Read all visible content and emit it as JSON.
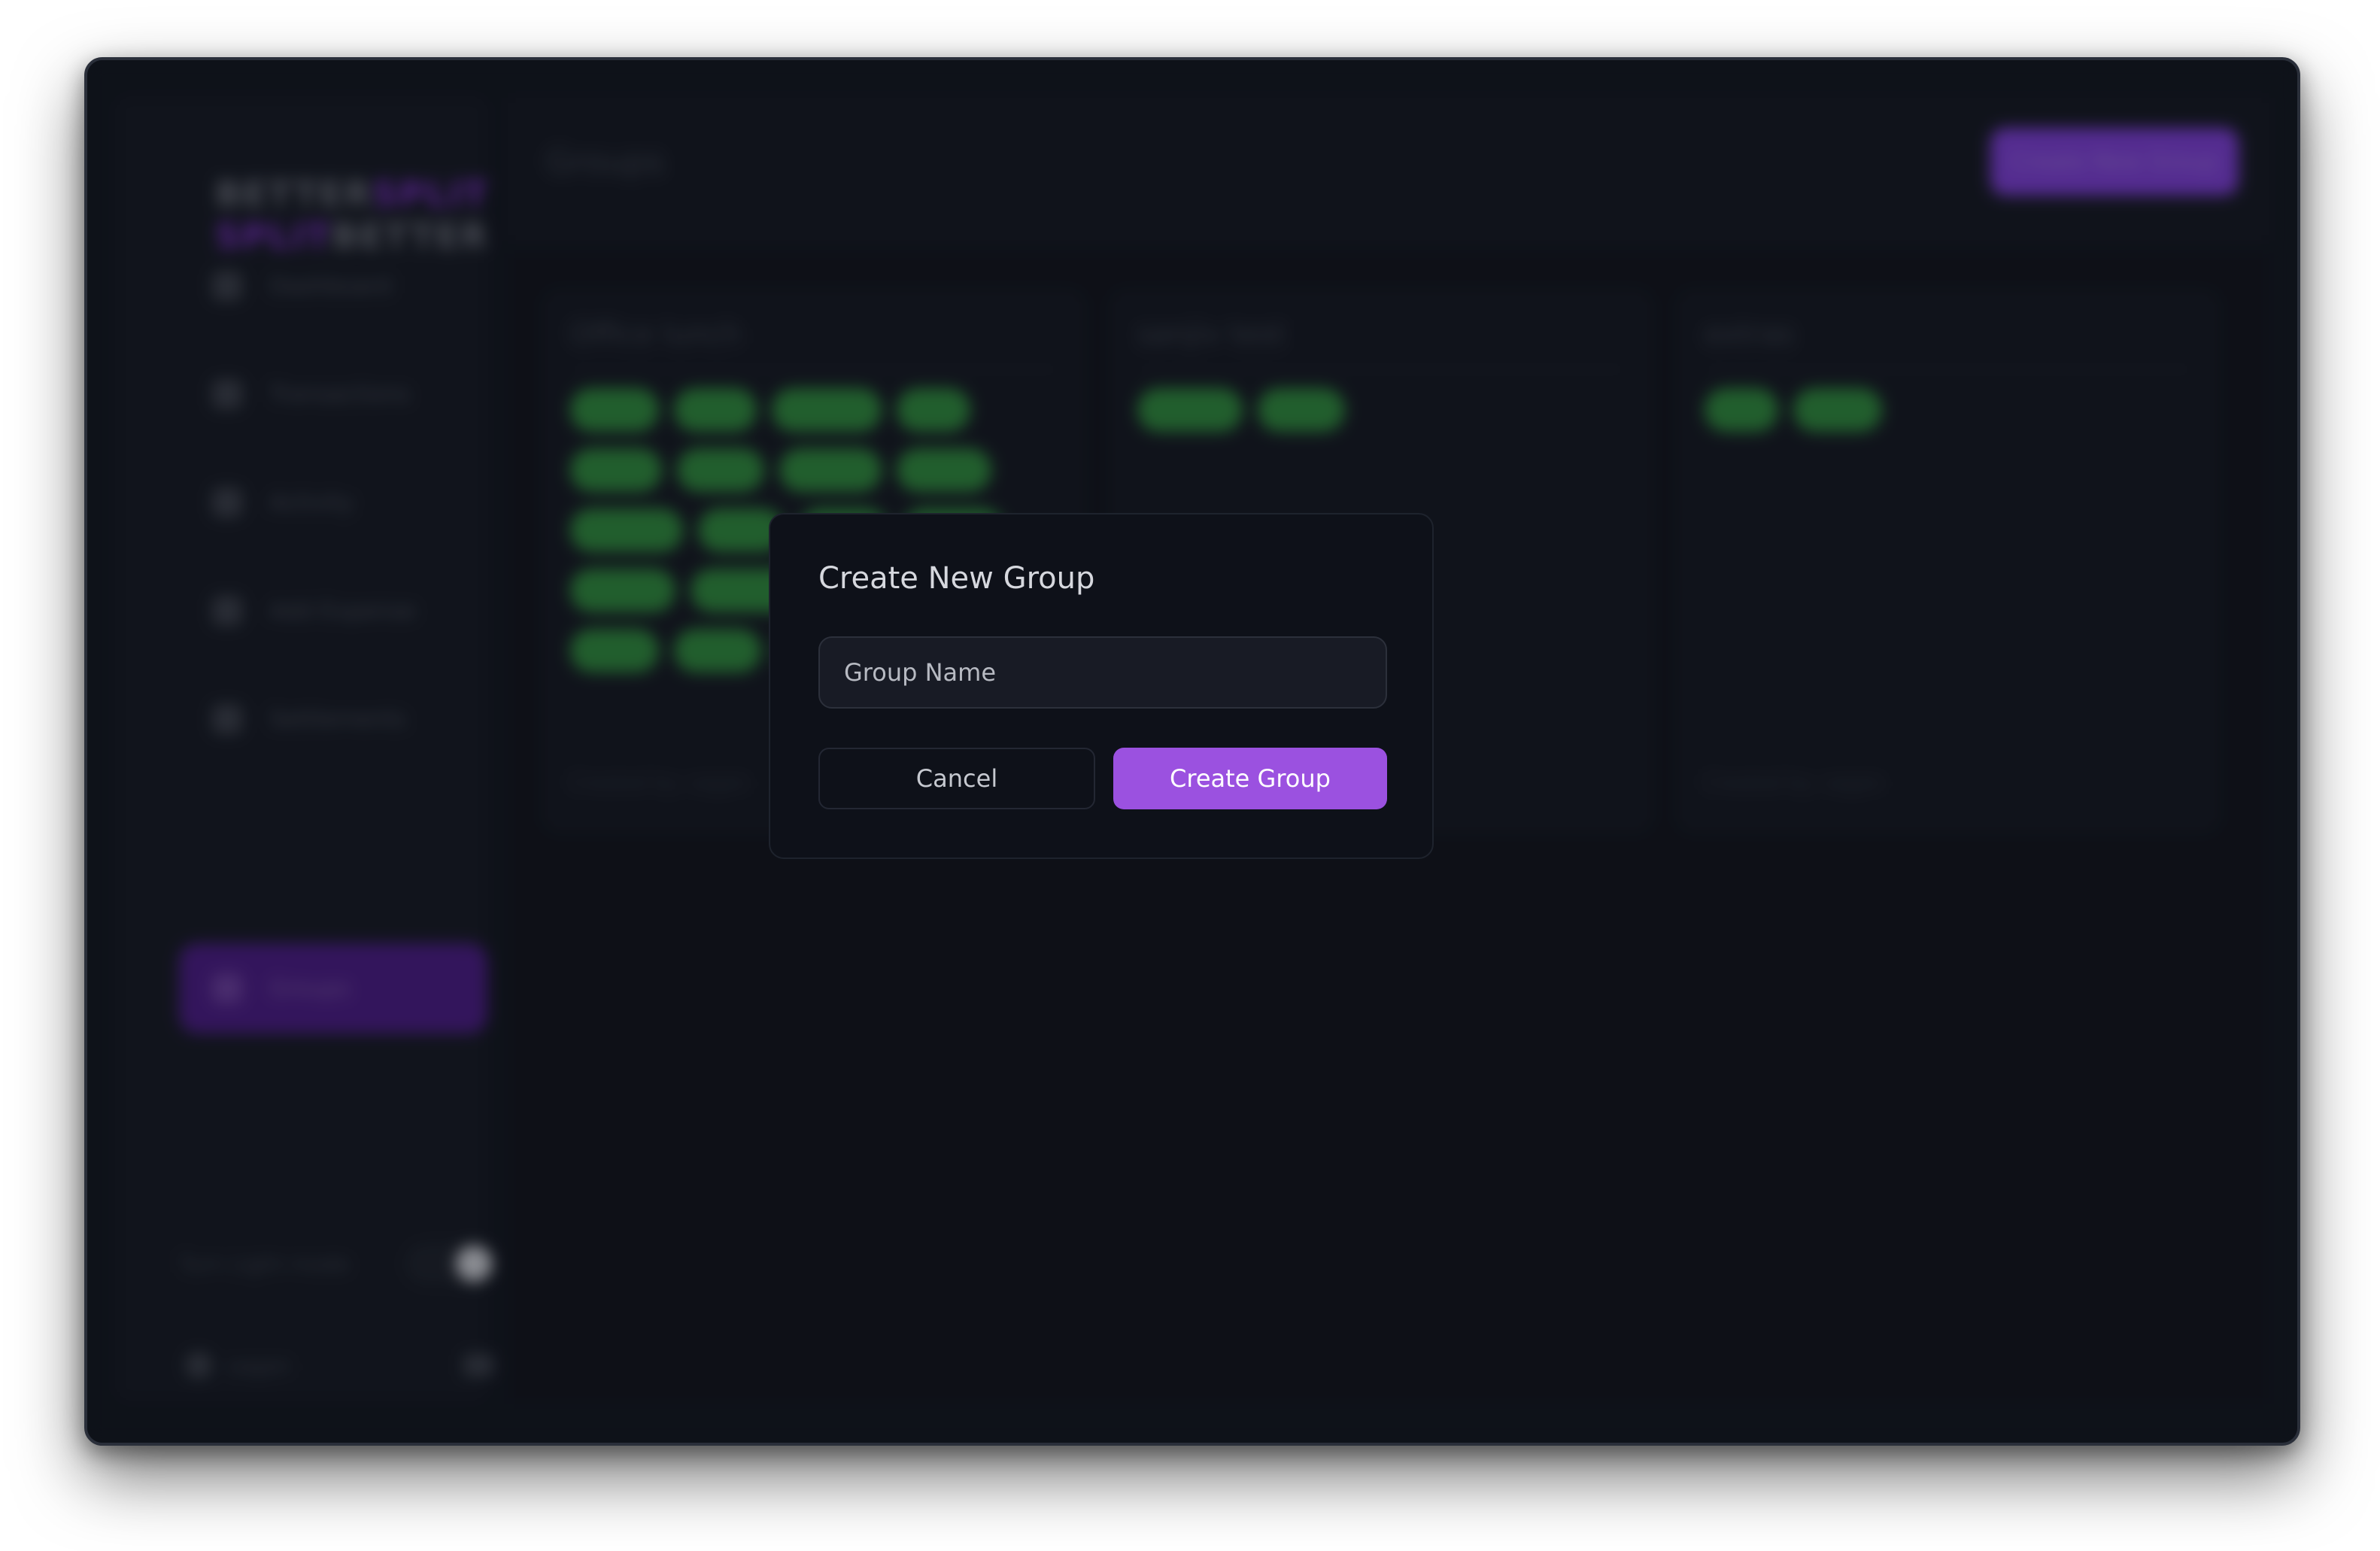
{
  "app": {
    "logo_top_a": "BETTER",
    "logo_top_b": "SPLIT",
    "logo_bottom_a": "SPLIT",
    "logo_bottom_b": "BETTER",
    "nav": [
      {
        "label": "Dashboard",
        "icon": "dashboard-icon"
      },
      {
        "label": "Transactions",
        "icon": "transactions-icon"
      },
      {
        "label": "Activity",
        "icon": "activity-icon"
      },
      {
        "label": "Add Expense",
        "icon": "plus-icon"
      },
      {
        "label": "Settlements",
        "icon": "settlements-icon"
      },
      {
        "label": "Groups",
        "icon": "groups-icon"
      }
    ],
    "theme_label": "Turn Light mode",
    "user_name": "sagan",
    "page_title": "Groups",
    "create_button": "Create New Group",
    "cards": [
      {
        "title": "Office lunch",
        "footer": "Created by: sagan"
      },
      {
        "title": "sanjiv test",
        "footer": ""
      },
      {
        "title": "extras",
        "footer": "Created by: sagan"
      }
    ]
  },
  "modal": {
    "title": "Create New Group",
    "input_placeholder": "Group Name",
    "input_value": "",
    "cancel_label": "Cancel",
    "submit_label": "Create Group"
  },
  "colors": {
    "accent": "#9b51e0",
    "chip": "#2f8c3e",
    "background": "#11151d"
  }
}
